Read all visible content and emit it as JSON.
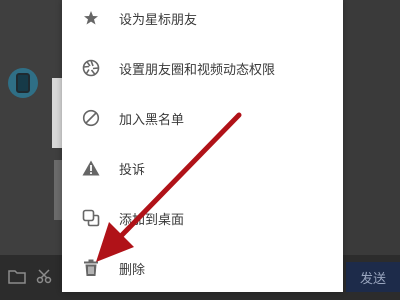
{
  "menu": {
    "items": [
      {
        "label": "设为星标朋友",
        "icon": "star-icon"
      },
      {
        "label": "设置朋友圈和视频动态权限",
        "icon": "aperture-icon"
      },
      {
        "label": "加入黑名单",
        "icon": "block-icon"
      },
      {
        "label": "投诉",
        "icon": "warning-icon"
      },
      {
        "label": "添加到桌面",
        "icon": "add-to-desktop-icon"
      },
      {
        "label": "删除",
        "icon": "trash-icon"
      }
    ]
  },
  "toolbar": {
    "send_label": "发送"
  },
  "colors": {
    "annotation_arrow": "#b01218",
    "menu_text": "#3a3a3a",
    "icon": "#666666"
  }
}
